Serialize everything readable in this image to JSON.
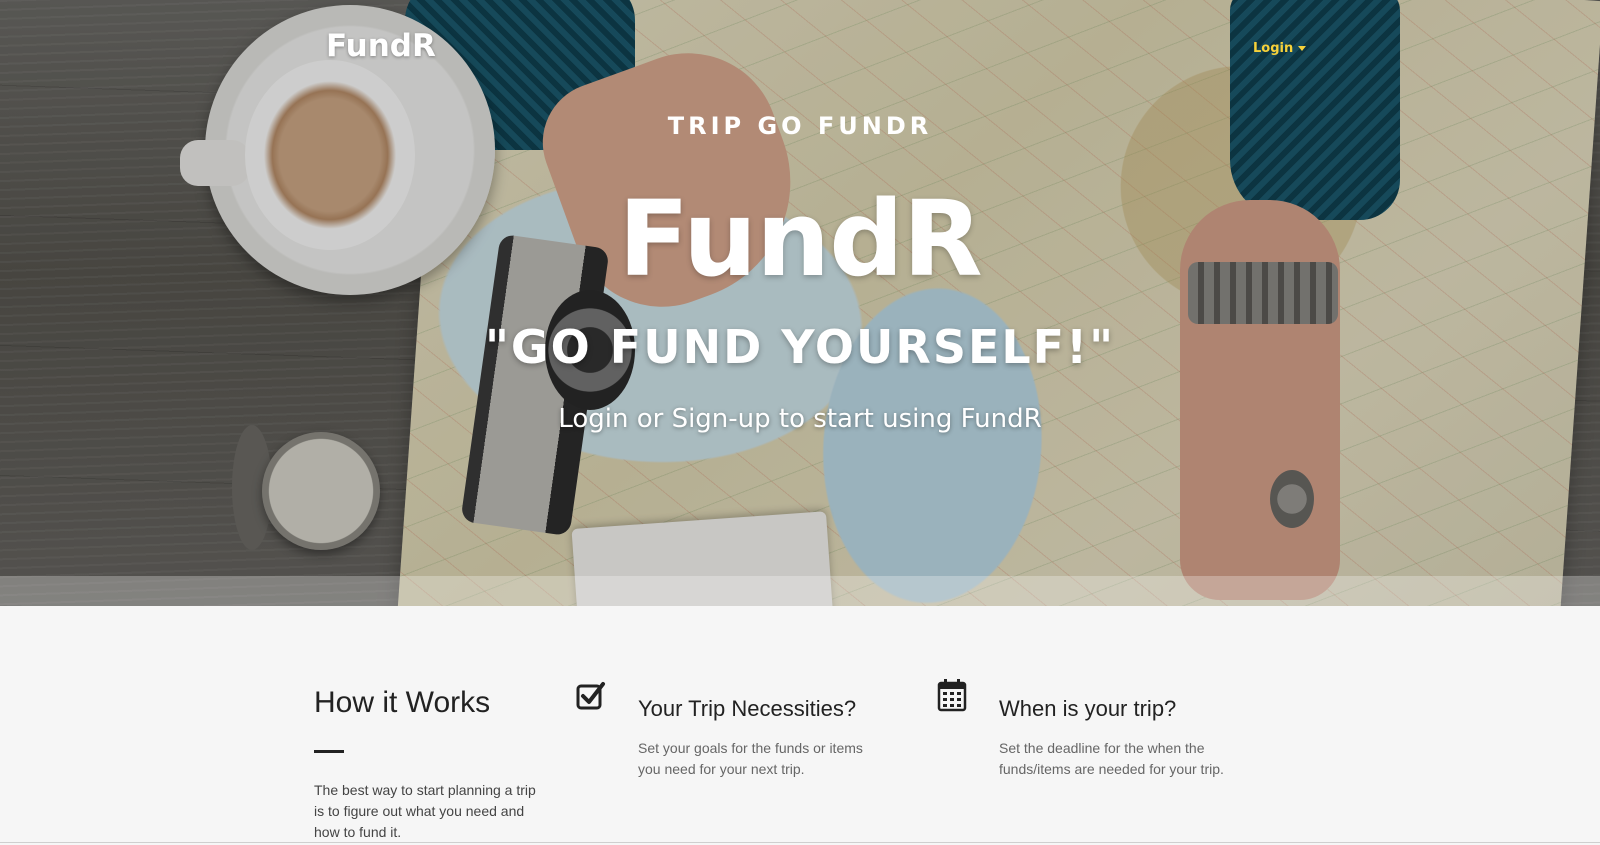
{
  "nav": {
    "brand": "FundR",
    "login_label": "Login"
  },
  "hero": {
    "kicker": "TRIP GO FUNDR",
    "title": "FundR",
    "tagline": "\"GO FUND YOURSELF!\"",
    "subline": "Login or Sign-up to start using FundR"
  },
  "how_it_works": {
    "title": "How it Works",
    "text": "The best way to start planning a trip is to figure out what you need and how to fund it."
  },
  "features": [
    {
      "icon": "checkbox-icon",
      "title": "Your Trip Necessities?",
      "text": "Set your goals for the funds or items you need for your next trip."
    },
    {
      "icon": "calendar-icon",
      "title": "When is your trip?",
      "text": "Set the deadline for the when the funds/items are needed for your trip."
    }
  ],
  "colors": {
    "login_accent": "#f6d13a",
    "hero_text": "#ffffff",
    "section_bg": "#f6f6f6"
  }
}
